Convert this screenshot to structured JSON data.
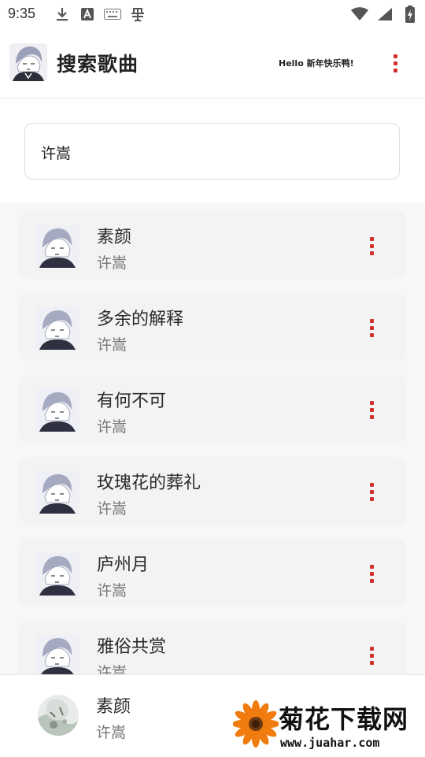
{
  "status_bar": {
    "time": "9:35",
    "left_icons": [
      "download-icon",
      "a-icon",
      "keyboard-icon",
      "bug-icon"
    ],
    "right_icons": [
      "wifi-icon",
      "signal-icon",
      "battery-icon"
    ]
  },
  "header": {
    "title": "搜索歌曲",
    "greeting": "Hello 新年快乐鸭!",
    "menu_icon": "more-vert-icon"
  },
  "search": {
    "value": "许嵩"
  },
  "songs": [
    {
      "title": "素颜",
      "artist": "许嵩"
    },
    {
      "title": "多余的解释",
      "artist": "许嵩"
    },
    {
      "title": "有何不可",
      "artist": "许嵩"
    },
    {
      "title": "玫瑰花的葬礼",
      "artist": "许嵩"
    },
    {
      "title": "庐州月",
      "artist": "许嵩"
    },
    {
      "title": "雅俗共赏",
      "artist": "许嵩"
    }
  ],
  "player": {
    "title": "素颜",
    "artist": "许嵩"
  },
  "watermark": {
    "name": "菊花下载网",
    "url": "www.juahar.com"
  },
  "colors": {
    "accent": "#d32f2f",
    "card": "#f3f3f3",
    "list_bg": "#f7f7f7"
  }
}
